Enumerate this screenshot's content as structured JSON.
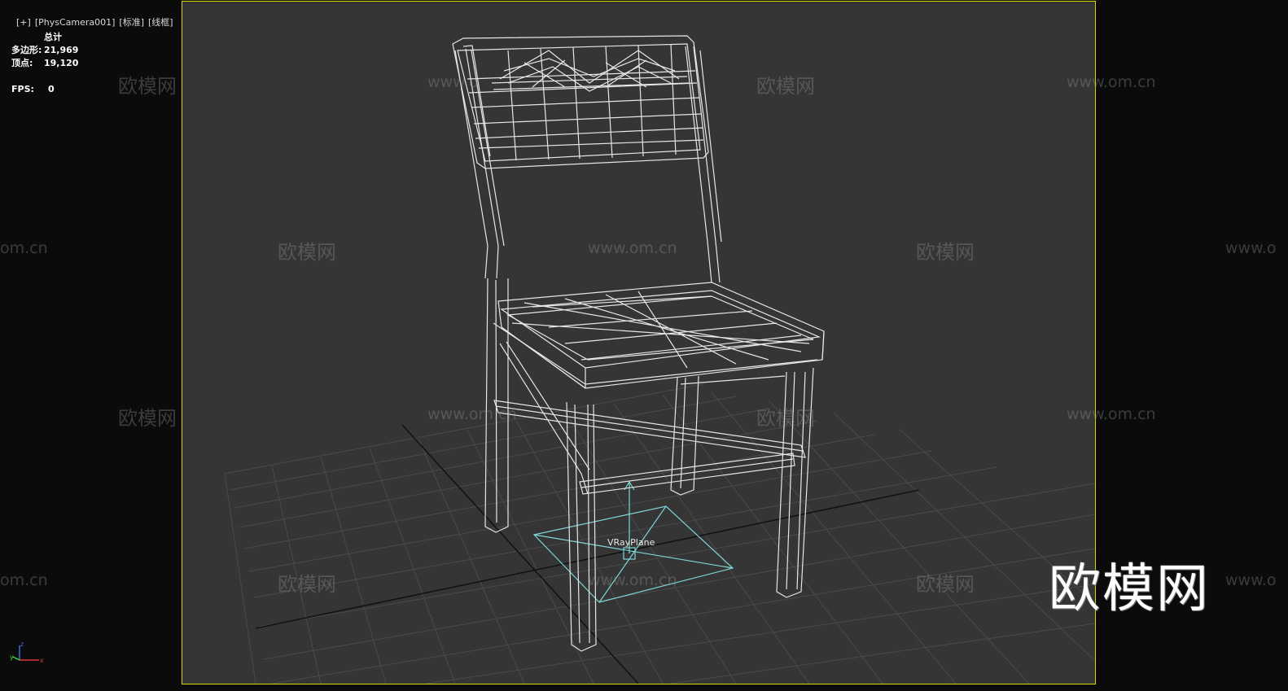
{
  "viewport": {
    "plus": "[+]",
    "camera": "[PhysCamera001]",
    "shading": "[标准]",
    "mode": "[线框]"
  },
  "stats": {
    "header": "总计",
    "polys_label": "多边形:",
    "polys_value": "21,969",
    "verts_label": "顶点:",
    "verts_value": "19,120",
    "fps_label": "FPS:",
    "fps_value": "0"
  },
  "scene": {
    "object_label": "VRayPlane",
    "wireframe_color": "#e6e6e6",
    "light_color": "#7fd6d6",
    "frame_color": "#d6d600"
  },
  "watermarks": {
    "cn": "欧模网",
    "url": "www.om.cn",
    "url_short": "om.cn",
    "url_trunc": "www.o",
    "logo": "欧模网"
  },
  "gizmo": {
    "z": "z",
    "x": "x",
    "y": "y"
  }
}
